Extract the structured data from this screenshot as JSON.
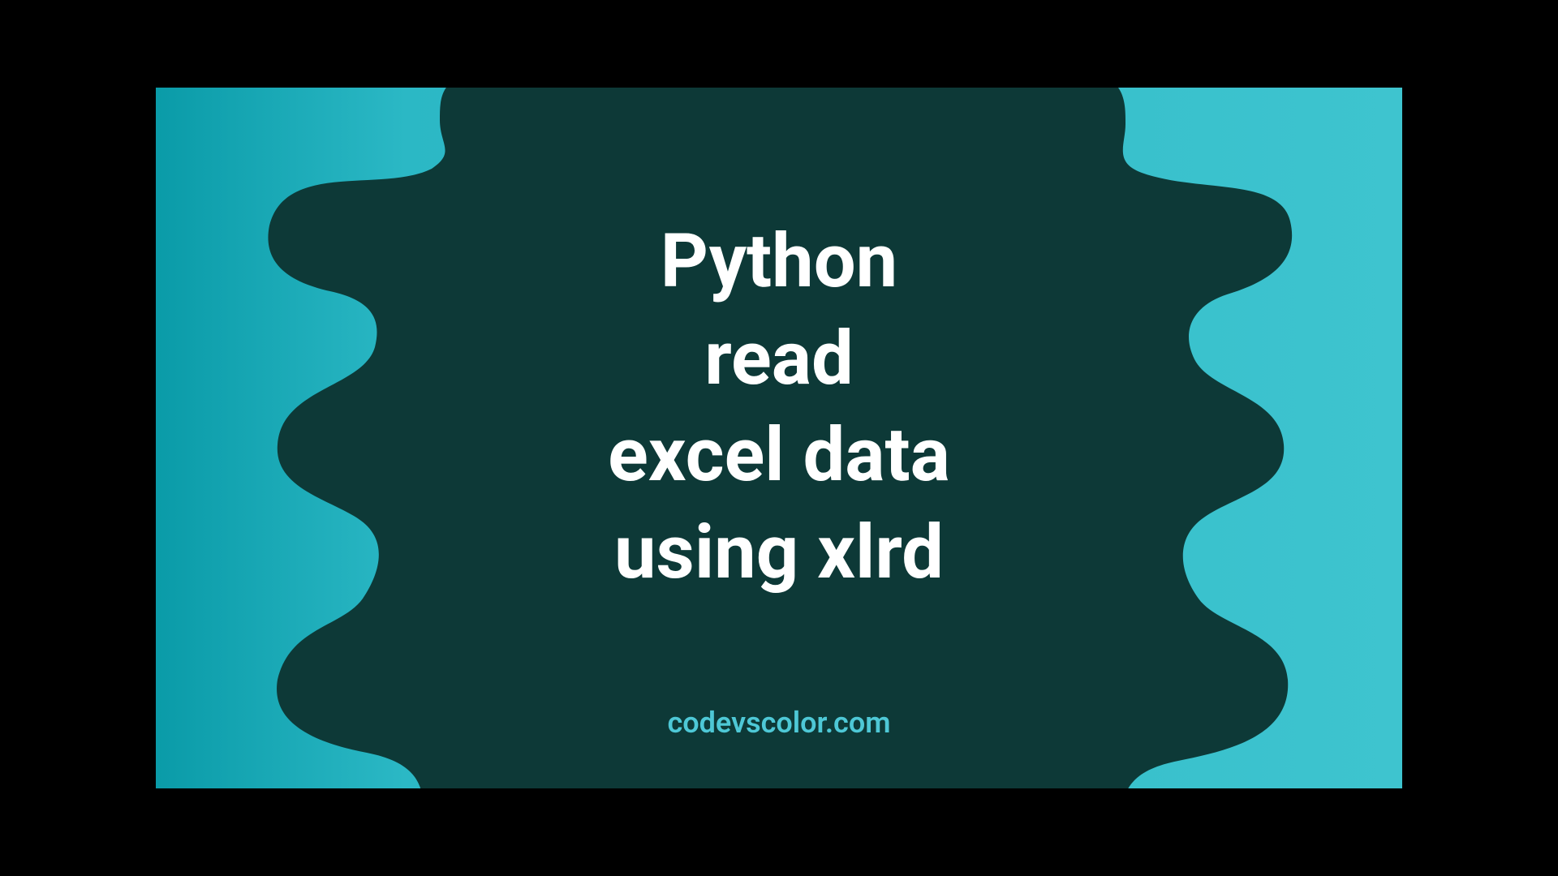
{
  "title": {
    "line1": "Python",
    "line2": "read",
    "line3": "excel data",
    "line4": "using xlrd"
  },
  "attribution": "codevscolor.com",
  "colors": {
    "blob": "#0d3937",
    "gradientStart": "#0a9ba8",
    "gradientEnd": "#3ec4cf",
    "titleText": "#ffffff",
    "attributionText": "#4ec8d6"
  }
}
